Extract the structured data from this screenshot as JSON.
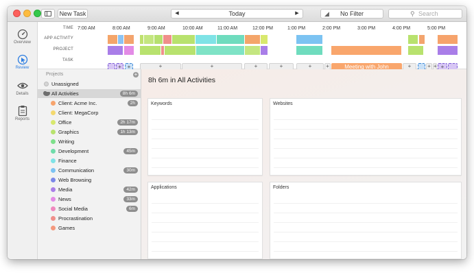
{
  "window": {
    "new_task_label": "New Task",
    "date_label": "Today",
    "filter_label": "No Filter",
    "search_placeholder": "Search"
  },
  "nav": [
    {
      "label": "Overview",
      "icon": "gauge-icon"
    },
    {
      "label": "Review",
      "icon": "cursor-icon"
    },
    {
      "label": "Details",
      "icon": "eye-icon"
    },
    {
      "label": "Reports",
      "icon": "clipboard-icon"
    }
  ],
  "timeline": {
    "row_labels": [
      "TIME",
      "APP ACTIVITY",
      "PROJECT",
      "TASK"
    ],
    "hours": [
      "7:00 AM",
      "8:00 AM",
      "9:00 AM",
      "10:00 AM",
      "11:00 AM",
      "12:00 PM",
      "1:00 PM",
      "2:00 PM",
      "3:00 PM",
      "4:00 PM",
      "5:00 PM"
    ],
    "task_meeting": "Meeting with John",
    "add_symbol": "+"
  },
  "projects": {
    "header": "Projects",
    "unassigned": "Unassigned",
    "all_label": "All Activities",
    "all_badge": "8h 6m",
    "items": [
      {
        "label": "Client: Acme Inc.",
        "color": "#f7a46d",
        "badge": "2h"
      },
      {
        "label": "Client: MegaCorp",
        "color": "#f4d96f",
        "badge": ""
      },
      {
        "label": "Office",
        "color": "#d8e86e",
        "badge": "2h 17m"
      },
      {
        "label": "Graphics",
        "color": "#b8e26e",
        "badge": "1h 13m"
      },
      {
        "label": "Writing",
        "color": "#7ee08b",
        "badge": ""
      },
      {
        "label": "Development",
        "color": "#6fdcaa",
        "badge": "45m"
      },
      {
        "label": "Finance",
        "color": "#7fe3e6",
        "badge": ""
      },
      {
        "label": "Communication",
        "color": "#7cc3f2",
        "badge": "30m"
      },
      {
        "label": "Web Browsing",
        "color": "#7b88e8",
        "badge": ""
      },
      {
        "label": "Media",
        "color": "#a97ee8",
        "badge": "42m"
      },
      {
        "label": "News",
        "color": "#e38be6",
        "badge": "33m"
      },
      {
        "label": "Social Media",
        "color": "#f089bf",
        "badge": "6m"
      },
      {
        "label": "Procrastination",
        "color": "#f08f8a",
        "badge": ""
      },
      {
        "label": "Games",
        "color": "#f4997e",
        "badge": ""
      }
    ]
  },
  "content": {
    "title": "8h 6m in All Activities",
    "panels": [
      "Keywords",
      "Websites",
      "Applications",
      "Folders"
    ]
  },
  "colors": {
    "accent": "#2b7de1",
    "meeting": "#f9a66c",
    "task_dashed": "#7a5bd6"
  }
}
